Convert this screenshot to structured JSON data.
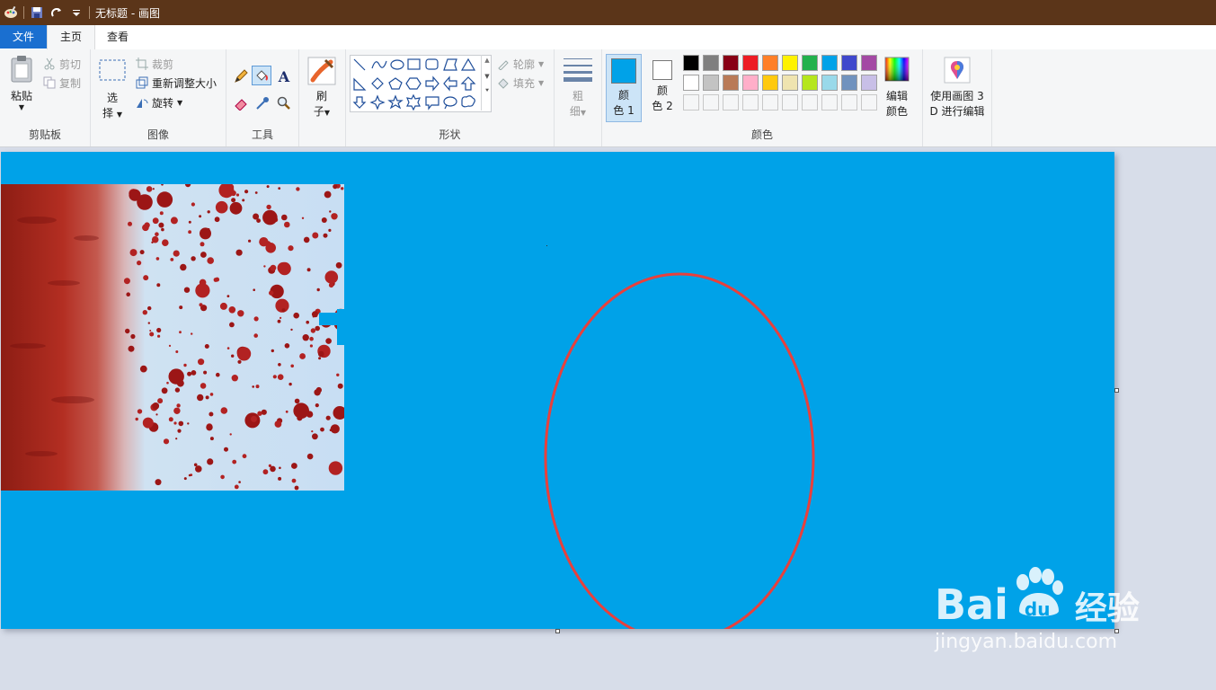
{
  "window": {
    "title": "无标题 - 画图"
  },
  "tabs": [
    {
      "label": "文件"
    },
    {
      "label": "主页"
    },
    {
      "label": "查看"
    }
  ],
  "ribbon": {
    "clipboard": {
      "paste": "粘贴",
      "cut": "剪切",
      "copy": "复制",
      "group": "剪贴板"
    },
    "image": {
      "select_line1": "选",
      "select_line2": "择",
      "crop": "裁剪",
      "resize": "重新调整大小",
      "rotate": "旋转",
      "group": "图像"
    },
    "tools": {
      "group": "工具"
    },
    "brushes": {
      "line1": "刷",
      "line2": "子"
    },
    "shapes": {
      "outline": "轮廓",
      "fill": "填充",
      "group": "形状"
    },
    "size": {
      "line1": "粗",
      "line2": "细"
    },
    "colors": {
      "color1_line1": "颜",
      "color1_line2": "色 1",
      "color2_line1": "颜",
      "color2_line2": "色 2",
      "edit_line1": "编辑",
      "edit_line2": "颜色",
      "group": "颜色",
      "color1_value": "#00a2e8",
      "color2_value": "#ffffff",
      "palette_row1": [
        "#000000",
        "#7f7f7f",
        "#880015",
        "#ed1c24",
        "#ff7f27",
        "#fff200",
        "#22b14c",
        "#00a2e8",
        "#3f48cc",
        "#a349a4"
      ],
      "palette_row2": [
        "#ffffff",
        "#c3c3c3",
        "#b97a57",
        "#ffaec9",
        "#ffc90e",
        "#efe4b0",
        "#b5e61d",
        "#99d9ea",
        "#7092be",
        "#c8bfe7"
      ]
    },
    "paint3d": {
      "line1": "使用画图 3",
      "line2": "D 进行编辑"
    }
  },
  "canvas": {
    "background": "#00a2e8",
    "ellipse_color": "#e8403c"
  },
  "watermark": {
    "brand_latin1": "Bai",
    "brand_latin2": "du",
    "brand_cn": "经验",
    "url": "jingyan.baidu.com"
  }
}
